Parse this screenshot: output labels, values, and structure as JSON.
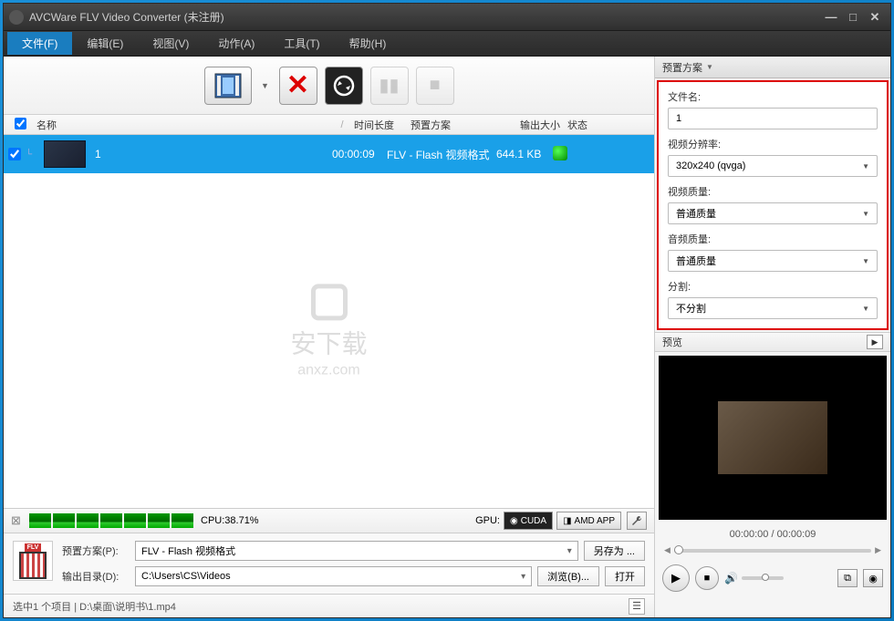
{
  "title": "AVCWare FLV Video Converter (未注册)",
  "menu": {
    "file": "文件(F)",
    "edit": "编辑(E)",
    "view": "视图(V)",
    "action": "动作(A)",
    "tools": "工具(T)",
    "help": "帮助(H)"
  },
  "columns": {
    "name": "名称",
    "sep": "/",
    "duration": "时间长度",
    "preset": "预置方案",
    "size": "输出大小",
    "status": "状态"
  },
  "row": {
    "name": "1",
    "duration": "00:00:09",
    "preset": "FLV - Flash 视频格式",
    "size": "644.1 KB"
  },
  "cpu": {
    "label": "CPU:38.71%",
    "gpu_label": "GPU:",
    "cuda": "CUDA",
    "amd": "AMD APP"
  },
  "bottom": {
    "preset_label": "预置方案(P):",
    "preset_value": "FLV - Flash 视频格式",
    "saveas": "另存为 ...",
    "outdir_label": "输出目录(D):",
    "outdir_value": "C:\\Users\\CS\\Videos",
    "browse": "浏览(B)...",
    "open": "打开"
  },
  "status": "选中1 个项目 | D:\\桌面\\说明书\\1.mp4",
  "right": {
    "preset_head": "预置方案",
    "filename_label": "文件名:",
    "filename_value": "1",
    "res_label": "视频分辨率:",
    "res_value": "320x240 (qvga)",
    "vq_label": "视频质量:",
    "vq_value": "普通质量",
    "aq_label": "音频质量:",
    "aq_value": "普通质量",
    "split_label": "分割:",
    "split_value": "不分割",
    "preview_label": "预览",
    "time": "00:00:00 / 00:00:09"
  },
  "watermark": {
    "line1": "安下载",
    "line2": "anxz.com"
  }
}
